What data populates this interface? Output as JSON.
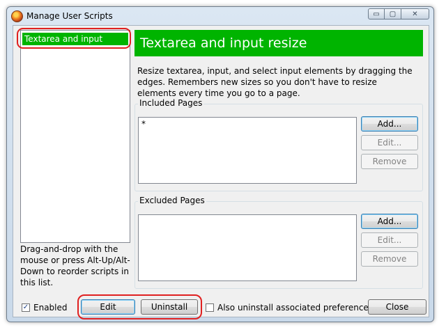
{
  "window": {
    "title": "Manage User Scripts",
    "controls": {
      "minimize": "▭",
      "maximize": "▢",
      "close": "✕"
    }
  },
  "scripts": {
    "items": [
      {
        "label": "Textarea and input resize",
        "selected": true
      }
    ]
  },
  "hint": "Drag-and-drop with the mouse or press Alt-Up/Alt-Down to reorder scripts in this list.",
  "details": {
    "title": "Textarea and input resize",
    "description": "Resize textarea, input, and select input elements by dragging the edges. Remembers new sizes so you don't have to resize elements every time you go to a page.",
    "included": {
      "label": "Included Pages",
      "pages": "*",
      "add": "Add...",
      "edit": "Edit...",
      "remove": "Remove"
    },
    "excluded": {
      "label": "Excluded Pages",
      "pages": "",
      "add": "Add...",
      "edit": "Edit...",
      "remove": "Remove"
    }
  },
  "footer": {
    "enabled_label": "Enabled",
    "enabled_checked": "✓",
    "edit": "Edit",
    "uninstall": "Uninstall",
    "also_uninstall_label": "Also uninstall associated preferences",
    "close": "Close"
  },
  "colors": {
    "accent": "#00b400",
    "highlight": "#e02020"
  }
}
